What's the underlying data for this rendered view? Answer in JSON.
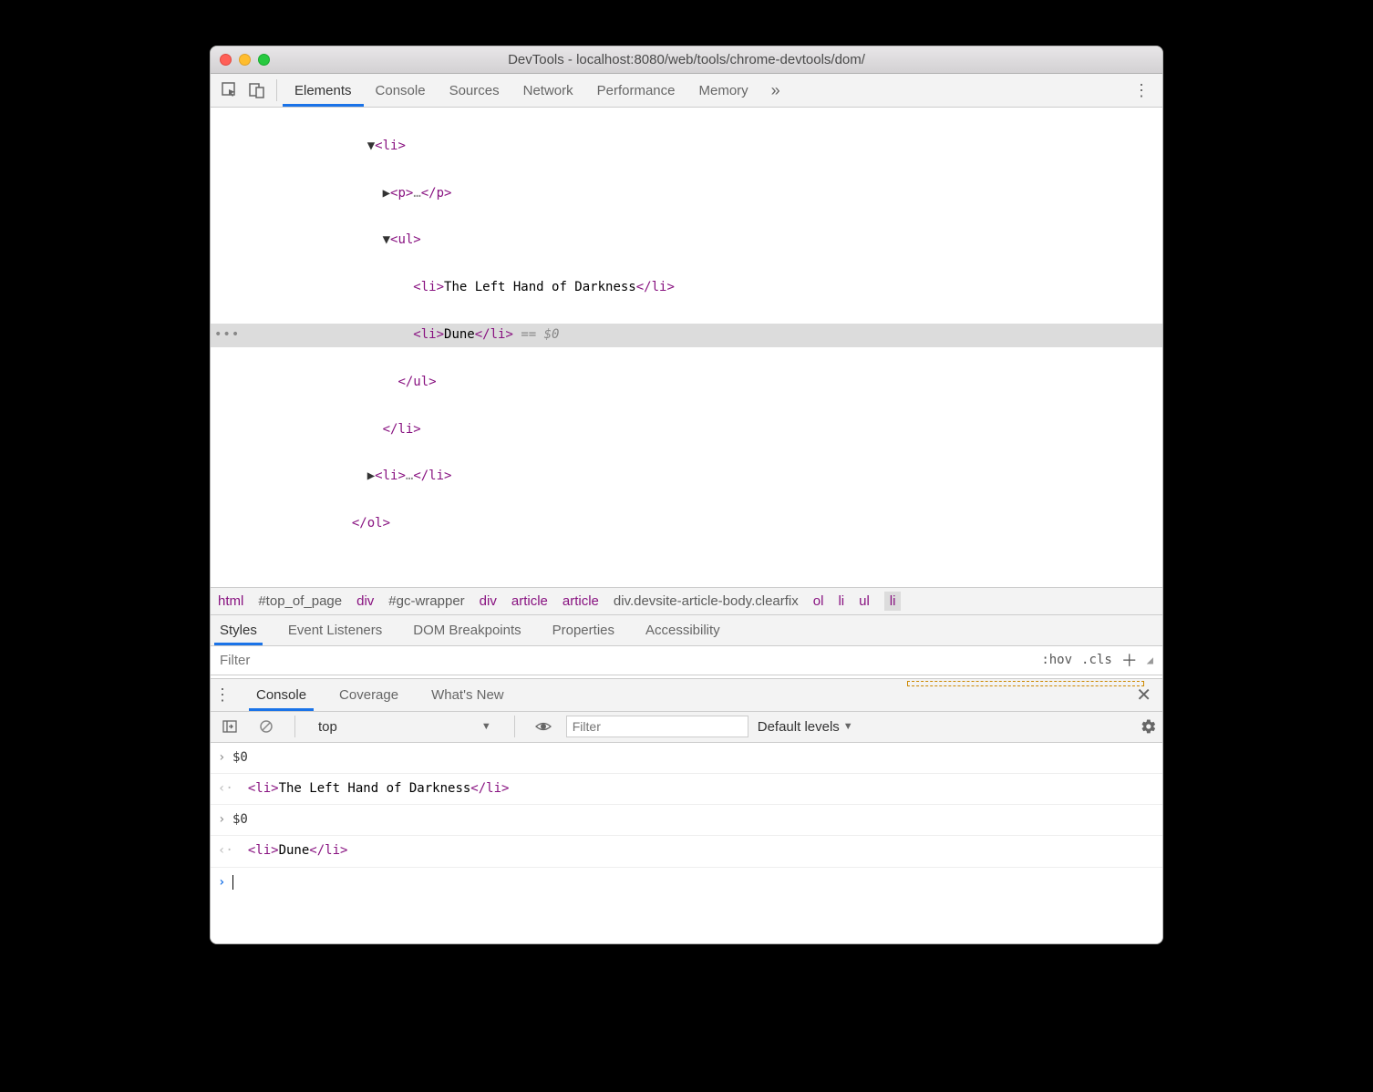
{
  "window": {
    "title": "DevTools - localhost:8080/web/tools/chrome-devtools/dom/"
  },
  "main_tabs": {
    "elements": "Elements",
    "console": "Console",
    "sources": "Sources",
    "network": "Network",
    "performance": "Performance",
    "memory": "Memory"
  },
  "dom": {
    "li_open": "<li>",
    "p_open": "<p>",
    "p_ell": "…",
    "p_close": "</p>",
    "ul_open": "<ul>",
    "li1_open": "<li>",
    "li1_text": "The Left Hand of Darkness",
    "li1_close": "</li>",
    "li2_open": "<li>",
    "li2_text": "Dune",
    "li2_close": "</li>",
    "eqvar": " == $0",
    "ul_close": "</ul>",
    "li_close": "</li>",
    "li3_open": "<li>",
    "li3_ell": "…",
    "li3_close": "</li>",
    "ol_close": "</ol>"
  },
  "breadcrumbs": {
    "c1": "html",
    "c2": "#top_of_page",
    "c3": "div",
    "c4": "#gc-wrapper",
    "c5": "div",
    "c6": "article",
    "c7": "article",
    "c8a": "div",
    "c8b": ".devsite-article-body.clearfix",
    "c9": "ol",
    "c10": "li",
    "c11": "ul",
    "c12": "li"
  },
  "subtabs": {
    "styles": "Styles",
    "listeners": "Event Listeners",
    "dombp": "DOM Breakpoints",
    "props": "Properties",
    "a11y": "Accessibility"
  },
  "filter": {
    "placeholder": "Filter",
    "hov": ":hov",
    "cls": ".cls"
  },
  "drawer": {
    "console": "Console",
    "coverage": "Coverage",
    "whatsnew": "What's New"
  },
  "console_toolbar": {
    "context": "top",
    "filter_placeholder": "Filter",
    "levels": "Default levels"
  },
  "console": {
    "r1_in": "$0",
    "r1_out_open": "<li>",
    "r1_out_text": "The Left Hand of Darkness",
    "r1_out_close": "</li>",
    "r2_in": "$0",
    "r2_out_open": "<li>",
    "r2_out_text": "Dune",
    "r2_out_close": "</li>"
  }
}
